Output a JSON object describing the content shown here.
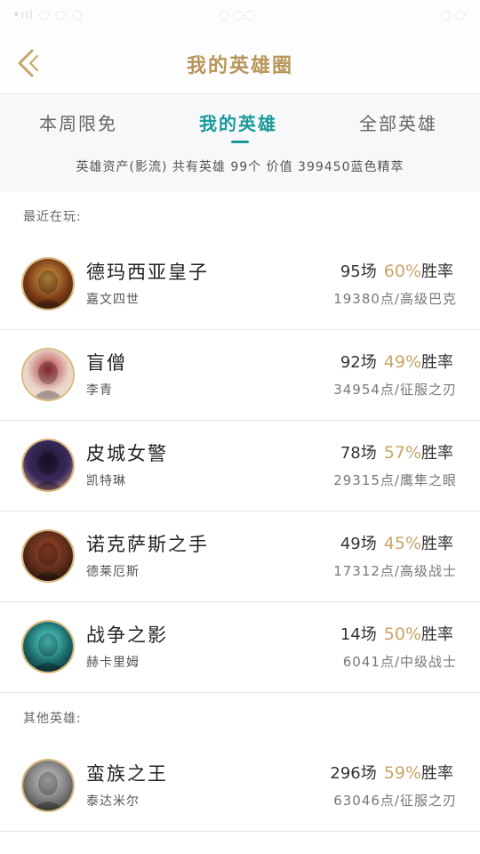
{
  "status_bar": {
    "left": "•ııl ◌ ◌ ◌",
    "center": "◌ ◌◌",
    "right": "◌  ◌"
  },
  "nav": {
    "title": "我的英雄圈"
  },
  "tabs": [
    {
      "label": "本周限免"
    },
    {
      "label": "我的英雄"
    },
    {
      "label": "全部英雄"
    }
  ],
  "summary": {
    "text": "英雄资产(影流)  共有英雄 99个  价值 399450蓝色精萃"
  },
  "sections": {
    "recent": "最近在玩:",
    "others": "其他英雄:"
  },
  "heroes": [
    {
      "name": "德玛西亚皇子",
      "title": "嘉文四世",
      "games": "95场",
      "winrate": "60%",
      "rate_label": "胜率",
      "detail": "19380点/高级巴克",
      "colors": [
        "#7a3a16",
        "#d9a548",
        "#3b1d0e"
      ]
    },
    {
      "name": "盲僧",
      "title": "李青",
      "games": "92场",
      "winrate": "49%",
      "rate_label": "胜率",
      "detail": "34954点/征服之刃",
      "colors": [
        "#e8d2c6",
        "#b0333d",
        "#f3e6de"
      ]
    },
    {
      "name": "皮城女警",
      "title": "凯特琳",
      "games": "78场",
      "winrate": "57%",
      "rate_label": "胜率",
      "detail": "29315点/鹰隼之眼",
      "colors": [
        "#3a2a5a",
        "#1c1733",
        "#c89a8a"
      ]
    },
    {
      "name": "诺克萨斯之手",
      "title": "德莱厄斯",
      "games": "49场",
      "winrate": "45%",
      "rate_label": "胜率",
      "detail": "17312点/高级战士",
      "colors": [
        "#5a2a18",
        "#a04a2a",
        "#1e1410"
      ]
    },
    {
      "name": "战争之影",
      "title": "赫卡里姆",
      "games": "14场",
      "winrate": "50%",
      "rate_label": "胜率",
      "detail": "6041点/中级战士",
      "colors": [
        "#1c6a6a",
        "#59e2d6",
        "#0e2a2e"
      ]
    },
    {
      "name": "蛮族之王",
      "title": "泰达米尔",
      "games": "296场",
      "winrate": "59%",
      "rate_label": "胜率",
      "detail": "63046点/征服之刃",
      "colors": [
        "#7a7a7a",
        "#c9c9c9",
        "#3a3a3a"
      ]
    }
  ]
}
